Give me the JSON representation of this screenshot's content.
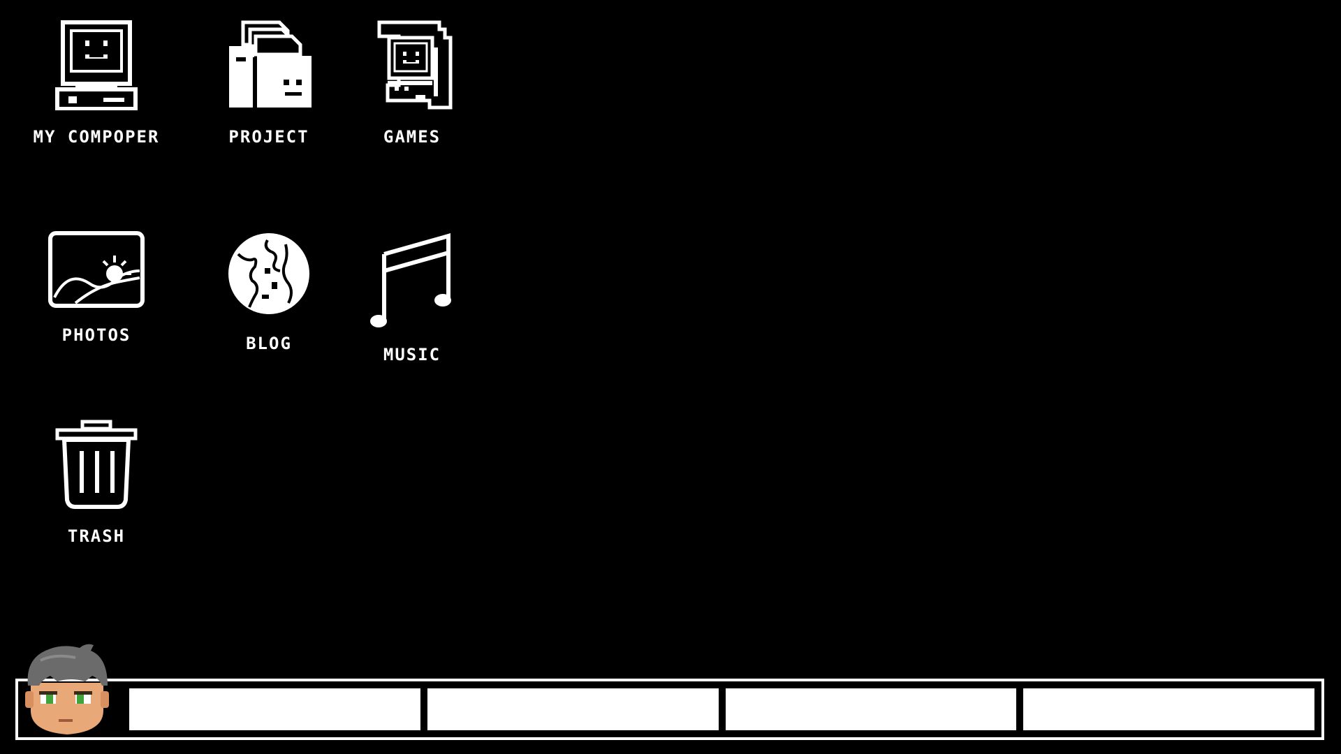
{
  "desktop": {
    "icons": [
      {
        "label": "MY COMPOPER",
        "icon": "computer-icon"
      },
      {
        "label": "PROJECT",
        "icon": "folder-icon"
      },
      {
        "label": "GAMES",
        "icon": "arcade-cabinet-icon"
      },
      {
        "label": "PHOTOS",
        "icon": "photo-landscape-icon"
      },
      {
        "label": "BLOG",
        "icon": "globe-icon"
      },
      {
        "label": "MUSIC",
        "icon": "music-note-icon"
      },
      {
        "label": "TRASH",
        "icon": "trash-can-icon"
      }
    ]
  },
  "taskbar": {
    "avatar": "user-avatar-icon",
    "slots": [
      "",
      "",
      "",
      ""
    ]
  },
  "colors": {
    "background": "#000000",
    "foreground": "#ffffff",
    "avatar_hair": "#6b6b6b",
    "avatar_skin": "#e8a878",
    "avatar_eyes": "#3fa43a"
  }
}
